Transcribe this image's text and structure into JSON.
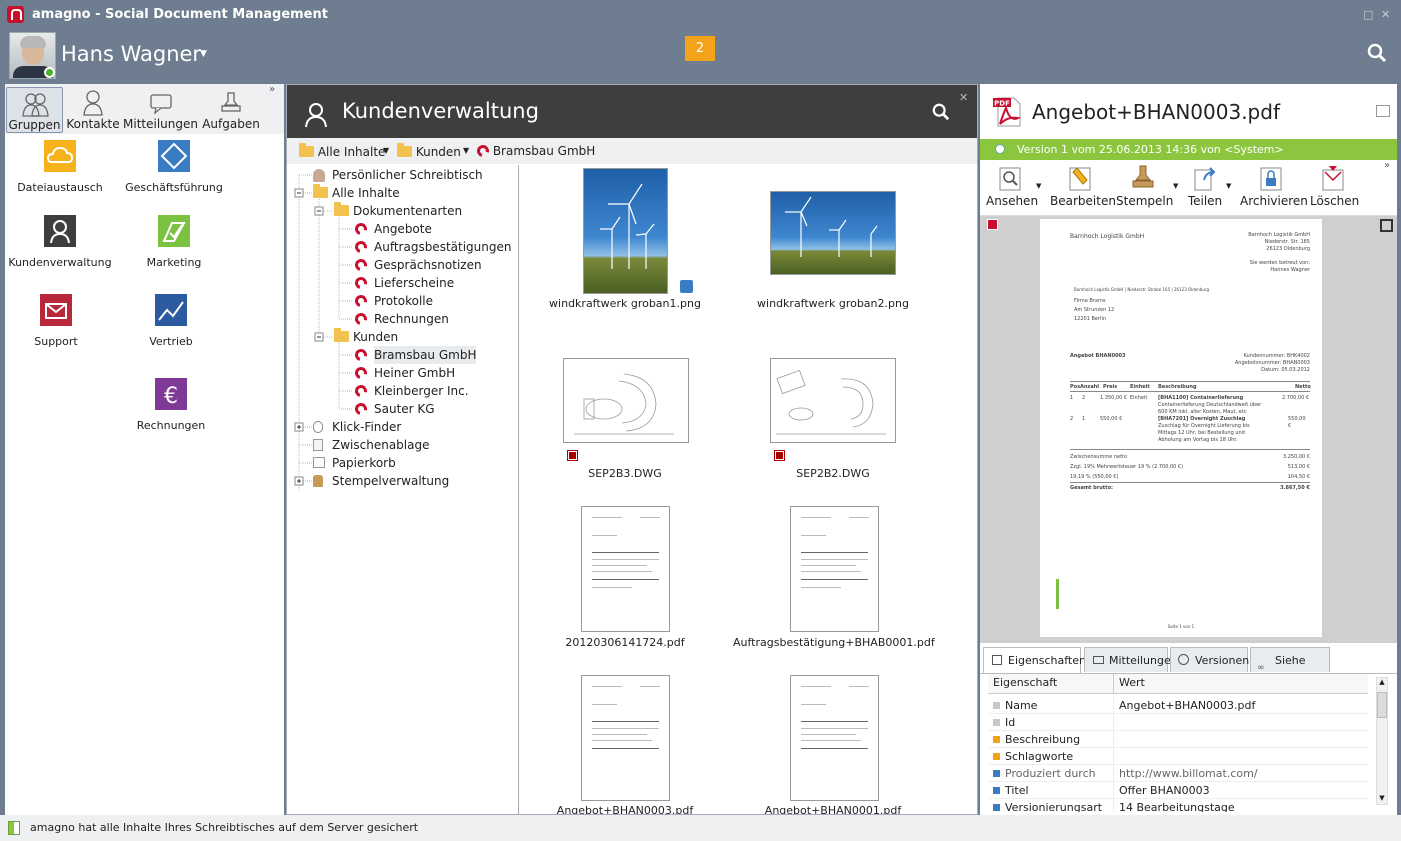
{
  "app": {
    "title": "amagno - Social Document Management"
  },
  "user": {
    "name": "Hans Wagner",
    "notifications": "2"
  },
  "left": {
    "tabs": [
      {
        "label": "Gruppen"
      },
      {
        "label": "Kontakte"
      },
      {
        "label": "Mitteilungen"
      },
      {
        "label": "Aufgaben"
      }
    ],
    "tiles": [
      {
        "label": "Dateiaustausch",
        "color": "#f5b21b"
      },
      {
        "label": "Geschäftsführung",
        "color": "#3a7cc4"
      },
      {
        "label": "Kundenverwaltung",
        "color": "#3e3e3e"
      },
      {
        "label": "Marketing",
        "color": "#7dc142"
      },
      {
        "label": "Support",
        "color": "#b8283a"
      },
      {
        "label": "Vertrieb",
        "color": "#2c5aa0"
      },
      {
        "label": "Rechnungen",
        "color": "#7e3a96"
      }
    ]
  },
  "middle": {
    "title": "Kundenverwaltung",
    "breadcrumb": [
      "Alle Inhalte",
      "Kunden",
      "Bramsbau GmbH"
    ],
    "tree": [
      "Persönlicher Schreibtisch",
      "Alle Inhalte",
      "Dokumentenarten",
      "Angebote",
      "Auftragsbestätigungen",
      "Gesprächsnotizen",
      "Lieferscheine",
      "Protokolle",
      "Rechnungen",
      "Kunden",
      "Bramsbau GmbH",
      "Heiner GmbH",
      "Kleinberger Inc.",
      "Sauter KG",
      "Klick-Finder",
      "Zwischenablage",
      "Papierkorb",
      "Stempelverwaltung"
    ],
    "files": [
      "windkraftwerk groban1.png",
      "windkraftwerk groban2.png",
      "SEP2B3.DWG",
      "SEP2B2.DWG",
      "20120306141724.pdf",
      "Auftragsbestätigung+BHAB0001.pdf",
      "Angebot+BHAN0003.pdf",
      "Angebot+BHAN0001.pdf"
    ]
  },
  "right": {
    "title": "Angebot+BHAN0003.pdf",
    "version": "Version 1 vom 25.06.2013 14:36 von <System>",
    "toolbar": [
      "Ansehen",
      "Bearbeiten",
      "Stempeln",
      "Teilen",
      "Archivieren",
      "Löschen"
    ],
    "preview": {
      "sender": "Barnhoch Logistik GmbH",
      "sender_addr": [
        "Barnhoch Logistik GmbH",
        "Niederstr. Str. 165",
        "26123 Oldenburg",
        "",
        "Sie werden betreut von:",
        "Hannes Wagner"
      ],
      "return_line": "Barnhoch Logistik GmbH | Niederstr. Strabe 165 | 26123 Oldenburg",
      "recipient": [
        "Firma Brams",
        "Am Strunzen 12",
        "12201 Berlin"
      ],
      "doc_title": "Angebot BHAN0003",
      "meta": [
        "Kundennummer:  BHK4002",
        "Angebotsnummer:  BHAN0003",
        "Datum:  05.03.2012"
      ],
      "cols": [
        "Pos",
        "Anzahl",
        "Preis",
        "Einheit",
        "Beschreibung",
        "Netto"
      ],
      "rows": [
        {
          "pos": "1",
          "qty": "2",
          "price": "1.350,00 €",
          "unit": "Einheit",
          "desc": [
            "[BHA1100] Containerlieferung",
            "Containerlieferung Deutschlandweit über",
            "600 KM inkl. aller Kosten, Maut, etc"
          ],
          "net": "2.700,00 €"
        },
        {
          "pos": "2",
          "qty": "1",
          "price": "550,00 €",
          "unit": "",
          "desc": [
            "[BHA7201] Overnight Zuschlag",
            "Zuschlag für Overnight Lieferung bis",
            "Mittags 12 Uhr, bei Bestellung und",
            "Abholung am Vortag bis 18 Uhr."
          ],
          "net": "550,00 €"
        }
      ],
      "totals": [
        [
          "Zwischensumme netto",
          "3.250,00 €"
        ],
        [
          "Zzgl. 19% Mehrwertsteuer 19 % (2.700,00 €)",
          "513,00 €"
        ],
        [
          "19,19 % (550,00 €)",
          "104,50 €"
        ],
        [
          "Gesamt brutto:",
          "3.867,50 €"
        ]
      ],
      "footer": "Seite 1 von 1"
    },
    "prop_tabs": [
      "Eigenschaften",
      "Mitteilungen",
      "Versionen",
      "Siehe auch"
    ],
    "prop_header": {
      "key": "Eigenschaft",
      "value": "Wert"
    },
    "props": [
      {
        "k": "Name",
        "v": "Angebot+BHAN0003.pdf",
        "c": "#c8c8c8"
      },
      {
        "k": "Id",
        "v": "",
        "c": "#c8c8c8"
      },
      {
        "k": "Beschreibung",
        "v": "",
        "c": "#f5a21b"
      },
      {
        "k": "Schlagworte",
        "v": "",
        "c": "#f5a21b"
      },
      {
        "k": "Produziert durch",
        "v": "http://www.billomat.com/",
        "c": "#3a7cc4"
      },
      {
        "k": "Titel",
        "v": "Offer BHAN0003",
        "c": "#3a7cc4"
      },
      {
        "k": "Versionierungsart",
        "v": "14 Bearbeitungstage",
        "c": "#3a7cc4"
      }
    ]
  },
  "status": {
    "text": "amagno hat alle Inhalte Ihres Schreibtisches auf dem Server gesichert"
  }
}
